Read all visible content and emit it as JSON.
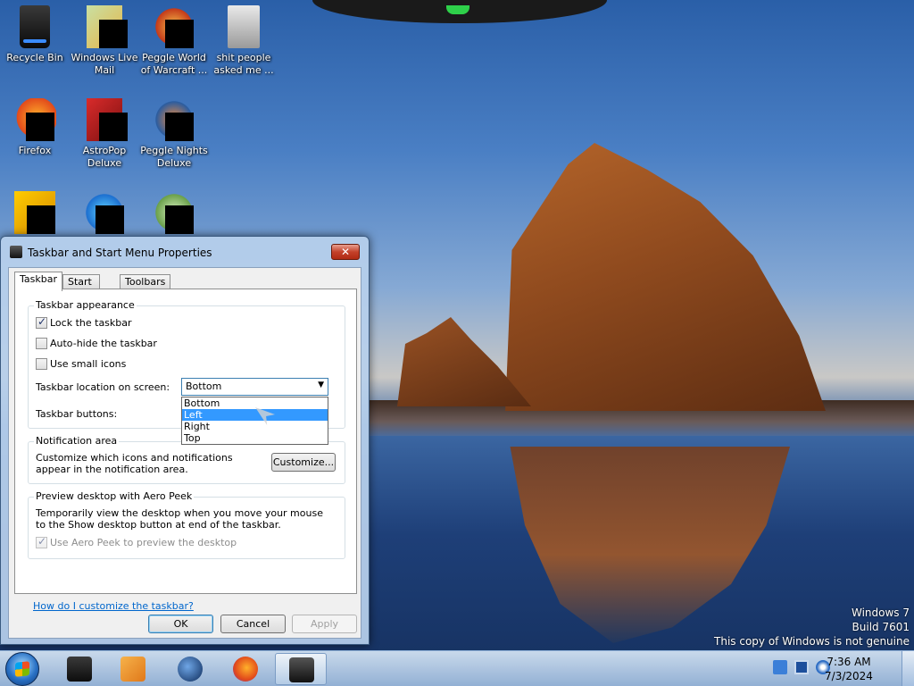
{
  "desktop": {
    "icons": [
      {
        "label": "Recycle Bin"
      },
      {
        "label": "Windows Live Mail"
      },
      {
        "label": "Peggle World of Warcraft ..."
      },
      {
        "label": "shit people asked me ..."
      },
      {
        "label": "Firefox"
      },
      {
        "label": "AstroPop Deluxe"
      },
      {
        "label": "Peggle Nights Deluxe"
      }
    ],
    "watermark": {
      "line1": "Windows 7",
      "line2": "Build 7601",
      "line3": "This copy of Windows is not genuine"
    }
  },
  "dialog": {
    "title": "Taskbar and Start Menu Properties",
    "close_label": "✕",
    "tabs": [
      {
        "label": "Taskbar"
      },
      {
        "label": "Start Menu"
      },
      {
        "label": "Toolbars"
      }
    ],
    "appearance": {
      "legend": "Taskbar appearance",
      "lock_label": "Lock the taskbar",
      "lock_checked": true,
      "autohide_label": "Auto-hide the taskbar",
      "autohide_checked": false,
      "small_icons_label": "Use small icons",
      "small_icons_checked": false,
      "location_label": "Taskbar location on screen:",
      "location_value": "Bottom",
      "location_options": [
        "Bottom",
        "Left",
        "Right",
        "Top"
      ],
      "location_highlighted": "Left",
      "buttons_label": "Taskbar buttons:"
    },
    "notification": {
      "legend": "Notification area",
      "text": "Customize which icons and notifications appear in the notification area.",
      "customize_label": "Customize..."
    },
    "aero": {
      "legend": "Preview desktop with Aero Peek",
      "text": "Temporarily view the desktop when you move your mouse to the Show desktop button at end of the taskbar.",
      "checkbox_label": "Use Aero Peek to preview the desktop",
      "checked": true,
      "disabled": true
    },
    "help_link": "How do I customize the taskbar?",
    "ok_label": "OK",
    "cancel_label": "Cancel",
    "apply_label": "Apply"
  },
  "taskbar": {
    "clock_time": "7:36 AM",
    "clock_date": "7/3/2024"
  },
  "colors": {
    "selection": "#3399ff",
    "link": "#0066cc"
  }
}
